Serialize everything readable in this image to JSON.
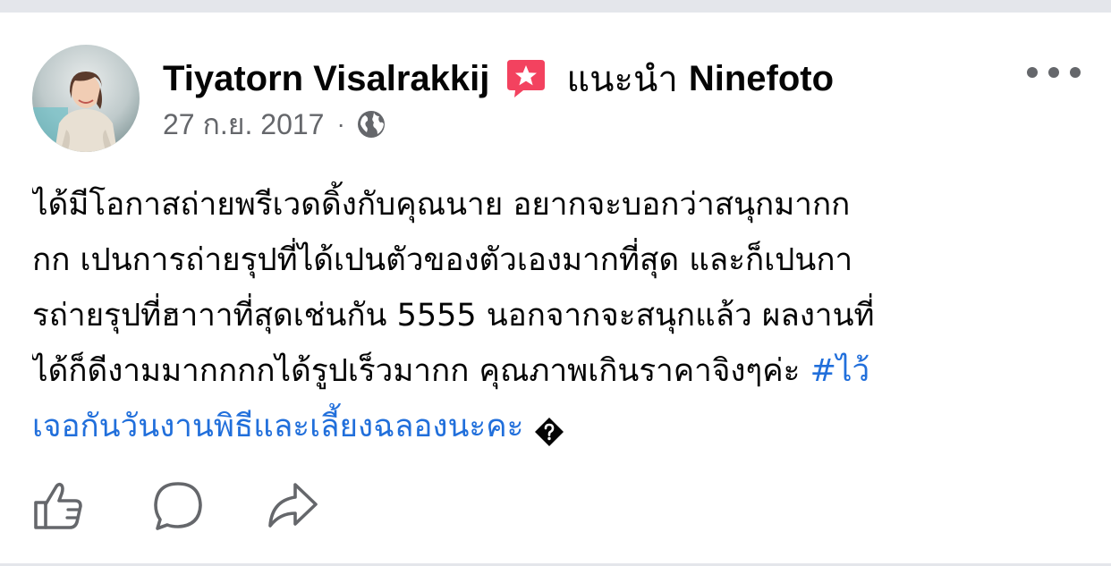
{
  "post": {
    "author": "Tiyatorn Visalrakkij",
    "recommend_label": "แนะนำ",
    "page_name": "Ninefoto",
    "date": "27 ก.ย. 2017",
    "separator": "·",
    "body_lines": [
      "ได้มีโอกาสถ่ายพรีเวดดิ้งกับคุณนาย อยากจะบอกว่าสนุกมากก",
      "กก เปนการถ่ายรุปที่ได้เปนตัวของตัวเองมากที่สุด และก็เปนกา",
      "รถ่ายรุปที่ฮาาาที่สุดเช่นกัน 5555 นอกจากจะสนุกแล้ว ผลงานที่",
      "ได้ก็ดีงามมากกกกได้รูปเร็วมากก คุณภาพเกินราคาจิงๆค่ะ "
    ],
    "hashtag_part1": "#ไว้",
    "hashtag_part2": "เจอกันวันงานพิธีและเลี้ยงฉลองนะคะ"
  },
  "icons": {
    "badge": "star-badge-icon",
    "audience": "globe-icon",
    "more": "more-options-icon",
    "like": "thumbs-up-icon",
    "comment": "comment-bubble-icon",
    "share": "share-arrow-icon",
    "unsupported_emoji": "unknown-glyph-icon"
  },
  "colors": {
    "text": "#050505",
    "secondary": "#65676b",
    "link": "#216fdb",
    "badge": "#f3425f",
    "divider": "#e4e6eb"
  }
}
